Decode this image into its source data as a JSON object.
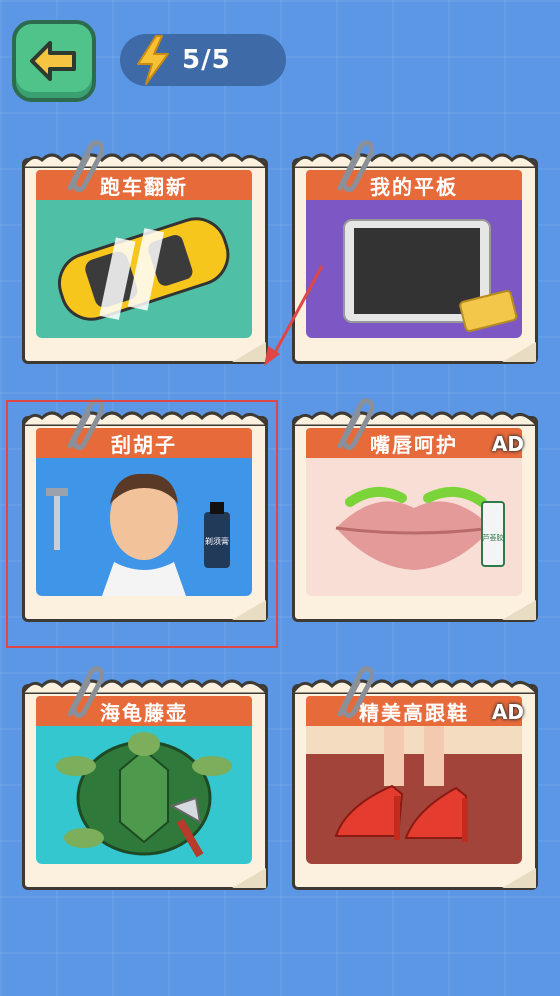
{
  "header": {
    "energy_text": "5/5",
    "back_icon": "arrow-left-icon",
    "energy_icon": "lightning-bolt-icon"
  },
  "cards": [
    {
      "title": "跑车翻新",
      "ad": ""
    },
    {
      "title": "我的平板",
      "ad": ""
    },
    {
      "title": "刮胡子",
      "ad": ""
    },
    {
      "title": "嘴唇呵护",
      "ad": "AD"
    },
    {
      "title": "海龟藤壶",
      "ad": ""
    },
    {
      "title": "精美高跟鞋",
      "ad": "AD"
    }
  ],
  "props": {
    "shave_bottle_label": "剃须膏",
    "toothpaste_label": "芦荟胶"
  },
  "colors": {
    "background": "#5b97e4",
    "banner": "#e66a3a",
    "back_button": "#4fc38a",
    "highlight_border": "#e04646"
  }
}
